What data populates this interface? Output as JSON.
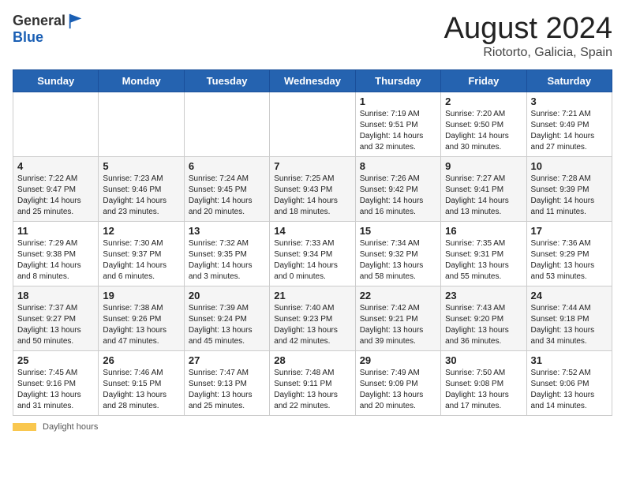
{
  "header": {
    "logo_line1": "General",
    "logo_line2": "Blue",
    "title": "August 2024",
    "subtitle": "Riotorto, Galicia, Spain"
  },
  "footer": {
    "legend_label": "Daylight hours"
  },
  "days_of_week": [
    "Sunday",
    "Monday",
    "Tuesday",
    "Wednesday",
    "Thursday",
    "Friday",
    "Saturday"
  ],
  "weeks": [
    [
      {
        "num": "",
        "info": ""
      },
      {
        "num": "",
        "info": ""
      },
      {
        "num": "",
        "info": ""
      },
      {
        "num": "",
        "info": ""
      },
      {
        "num": "1",
        "info": "Sunrise: 7:19 AM\nSunset: 9:51 PM\nDaylight: 14 hours\nand 32 minutes."
      },
      {
        "num": "2",
        "info": "Sunrise: 7:20 AM\nSunset: 9:50 PM\nDaylight: 14 hours\nand 30 minutes."
      },
      {
        "num": "3",
        "info": "Sunrise: 7:21 AM\nSunset: 9:49 PM\nDaylight: 14 hours\nand 27 minutes."
      }
    ],
    [
      {
        "num": "4",
        "info": "Sunrise: 7:22 AM\nSunset: 9:47 PM\nDaylight: 14 hours\nand 25 minutes."
      },
      {
        "num": "5",
        "info": "Sunrise: 7:23 AM\nSunset: 9:46 PM\nDaylight: 14 hours\nand 23 minutes."
      },
      {
        "num": "6",
        "info": "Sunrise: 7:24 AM\nSunset: 9:45 PM\nDaylight: 14 hours\nand 20 minutes."
      },
      {
        "num": "7",
        "info": "Sunrise: 7:25 AM\nSunset: 9:43 PM\nDaylight: 14 hours\nand 18 minutes."
      },
      {
        "num": "8",
        "info": "Sunrise: 7:26 AM\nSunset: 9:42 PM\nDaylight: 14 hours\nand 16 minutes."
      },
      {
        "num": "9",
        "info": "Sunrise: 7:27 AM\nSunset: 9:41 PM\nDaylight: 14 hours\nand 13 minutes."
      },
      {
        "num": "10",
        "info": "Sunrise: 7:28 AM\nSunset: 9:39 PM\nDaylight: 14 hours\nand 11 minutes."
      }
    ],
    [
      {
        "num": "11",
        "info": "Sunrise: 7:29 AM\nSunset: 9:38 PM\nDaylight: 14 hours\nand 8 minutes."
      },
      {
        "num": "12",
        "info": "Sunrise: 7:30 AM\nSunset: 9:37 PM\nDaylight: 14 hours\nand 6 minutes."
      },
      {
        "num": "13",
        "info": "Sunrise: 7:32 AM\nSunset: 9:35 PM\nDaylight: 14 hours\nand 3 minutes."
      },
      {
        "num": "14",
        "info": "Sunrise: 7:33 AM\nSunset: 9:34 PM\nDaylight: 14 hours\nand 0 minutes."
      },
      {
        "num": "15",
        "info": "Sunrise: 7:34 AM\nSunset: 9:32 PM\nDaylight: 13 hours\nand 58 minutes."
      },
      {
        "num": "16",
        "info": "Sunrise: 7:35 AM\nSunset: 9:31 PM\nDaylight: 13 hours\nand 55 minutes."
      },
      {
        "num": "17",
        "info": "Sunrise: 7:36 AM\nSunset: 9:29 PM\nDaylight: 13 hours\nand 53 minutes."
      }
    ],
    [
      {
        "num": "18",
        "info": "Sunrise: 7:37 AM\nSunset: 9:27 PM\nDaylight: 13 hours\nand 50 minutes."
      },
      {
        "num": "19",
        "info": "Sunrise: 7:38 AM\nSunset: 9:26 PM\nDaylight: 13 hours\nand 47 minutes."
      },
      {
        "num": "20",
        "info": "Sunrise: 7:39 AM\nSunset: 9:24 PM\nDaylight: 13 hours\nand 45 minutes."
      },
      {
        "num": "21",
        "info": "Sunrise: 7:40 AM\nSunset: 9:23 PM\nDaylight: 13 hours\nand 42 minutes."
      },
      {
        "num": "22",
        "info": "Sunrise: 7:42 AM\nSunset: 9:21 PM\nDaylight: 13 hours\nand 39 minutes."
      },
      {
        "num": "23",
        "info": "Sunrise: 7:43 AM\nSunset: 9:20 PM\nDaylight: 13 hours\nand 36 minutes."
      },
      {
        "num": "24",
        "info": "Sunrise: 7:44 AM\nSunset: 9:18 PM\nDaylight: 13 hours\nand 34 minutes."
      }
    ],
    [
      {
        "num": "25",
        "info": "Sunrise: 7:45 AM\nSunset: 9:16 PM\nDaylight: 13 hours\nand 31 minutes."
      },
      {
        "num": "26",
        "info": "Sunrise: 7:46 AM\nSunset: 9:15 PM\nDaylight: 13 hours\nand 28 minutes."
      },
      {
        "num": "27",
        "info": "Sunrise: 7:47 AM\nSunset: 9:13 PM\nDaylight: 13 hours\nand 25 minutes."
      },
      {
        "num": "28",
        "info": "Sunrise: 7:48 AM\nSunset: 9:11 PM\nDaylight: 13 hours\nand 22 minutes."
      },
      {
        "num": "29",
        "info": "Sunrise: 7:49 AM\nSunset: 9:09 PM\nDaylight: 13 hours\nand 20 minutes."
      },
      {
        "num": "30",
        "info": "Sunrise: 7:50 AM\nSunset: 9:08 PM\nDaylight: 13 hours\nand 17 minutes."
      },
      {
        "num": "31",
        "info": "Sunrise: 7:52 AM\nSunset: 9:06 PM\nDaylight: 13 hours\nand 14 minutes."
      }
    ]
  ]
}
